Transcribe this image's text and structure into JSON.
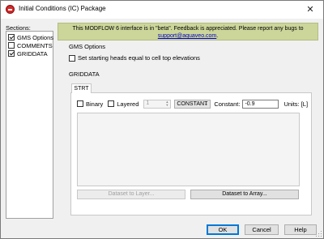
{
  "window": {
    "title": "Initial Conditions (IC) Package",
    "close_glyph": "✕",
    "icon": "app-icon"
  },
  "sections": {
    "label": "Sections:",
    "items": [
      {
        "label": "GMS Options",
        "checked": true
      },
      {
        "label": "COMMENTS",
        "checked": false
      },
      {
        "label": "GRIDDATA",
        "checked": true
      }
    ]
  },
  "banner": {
    "line1": "This MODFLOW 6 interface is in \"beta\". Feedback is appreciated. Please report any bugs to",
    "link": "support@aquaveo.com",
    "link_suffix": "."
  },
  "gms_options": {
    "title": "GMS Options",
    "starting_heads_label": "Set starting heads equal to cell top elevations",
    "starting_heads_checked": false
  },
  "griddata": {
    "title": "GRIDDATA",
    "tab_label": "STRT",
    "binary_label": "Binary",
    "binary_checked": false,
    "layered_label": "Layered",
    "layered_checked": false,
    "layer_value": "1",
    "type_value": "CONSTANT",
    "constant_label": "Constant:",
    "constant_value": "-0.9",
    "units_label": "Units: [L]",
    "dataset_to_layer": "Dataset to Layer...",
    "dataset_to_array": "Dataset to Array..."
  },
  "footer": {
    "ok": "OK",
    "cancel": "Cancel",
    "help": "Help"
  },
  "colors": {
    "banner_bg": "#ccd69a",
    "window_bg": "#f0f0f0",
    "link": "#0000cc",
    "default_button_border": "#0078d7"
  }
}
